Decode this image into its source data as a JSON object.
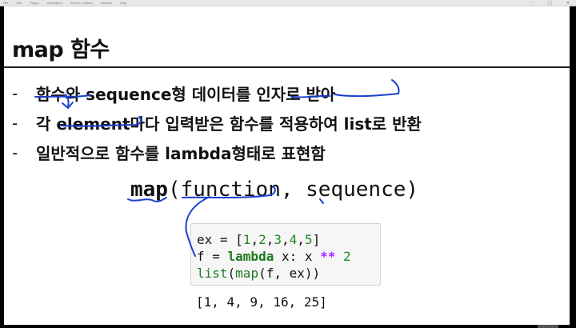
{
  "window": {
    "menu_items": [
      "File",
      "Edit",
      "Pages",
      "Annotation",
      "Screen Capture",
      "Window",
      "Help"
    ],
    "controls": [
      "–",
      "□",
      "✕"
    ]
  },
  "slide": {
    "title": "map 함수",
    "bullets": [
      "함수와 sequence형 데이터를 인자로 받아",
      "각 element마다 입력받은 함수를 적용하여 list로 반환",
      "일반적으로 함수를 lambda형태로 표현함"
    ],
    "bullet_marker": "-",
    "signature": {
      "name": "map",
      "args": "(function, sequence)"
    },
    "code": {
      "line1": {
        "var": "ex = [",
        "n1": "1",
        "c1": ",",
        "n2": "2",
        "c2": ",",
        "n3": "3",
        "c3": ",",
        "n4": "4",
        "c4": ",",
        "n5": "5",
        "end": "]"
      },
      "line2": {
        "head": "f = ",
        "kw": "lambda",
        "mid": " x: x ",
        "op": "**",
        "num": " 2"
      },
      "line3": {
        "b1": "list",
        "p1": "(",
        "b2": "map",
        "rest": "(f, ex))"
      }
    },
    "output": "[1, 4, 9, 16, 25]"
  },
  "colors": {
    "ink": "#1a3fd1",
    "keyword": "#1a7a1a",
    "number": "#1f8a1f",
    "operator": "#a022ff"
  }
}
